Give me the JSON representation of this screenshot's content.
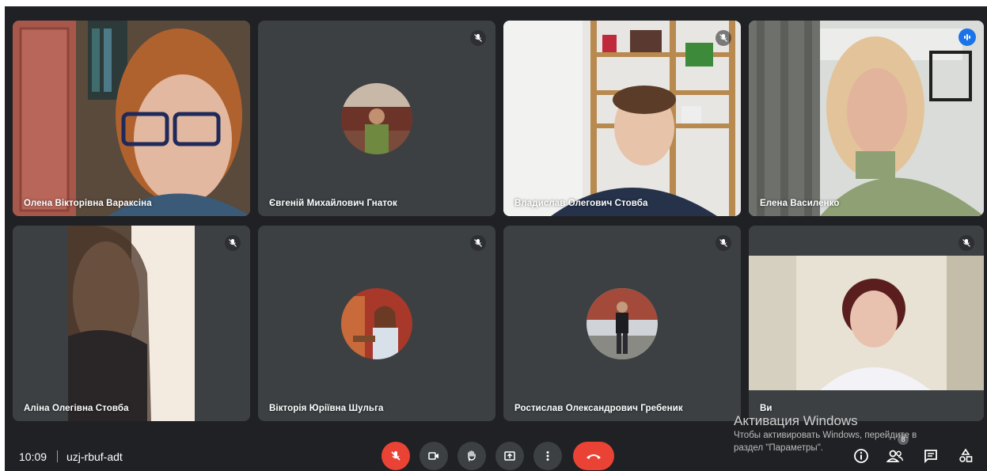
{
  "participants": [
    {
      "name": "Олена Вікторівна Вараксіна",
      "muted": false,
      "speaking": false
    },
    {
      "name": "Євгеній Михайлович Гнаток",
      "muted": true,
      "speaking": false
    },
    {
      "name": "Владислав Олегович Стовба",
      "muted": true,
      "speaking": false
    },
    {
      "name": "Елена Василенко",
      "muted": false,
      "speaking": true
    },
    {
      "name": "Аліна Олегівна Стовба",
      "muted": true,
      "speaking": false
    },
    {
      "name": "Вікторія Юріївна Шульга",
      "muted": true,
      "speaking": false
    },
    {
      "name": "Ростислав Олександрович Гребеник",
      "muted": true,
      "speaking": false
    },
    {
      "name": "Ви",
      "muted": true,
      "speaking": false
    }
  ],
  "meeting": {
    "time": "10:09",
    "code": "uzj-rbuf-adt",
    "people_count": "8"
  },
  "controls": {
    "icons": [
      "mic-off-icon",
      "camera-icon",
      "raise-hand-icon",
      "present-icon",
      "more-icon",
      "end-call-icon"
    ],
    "right_icons": [
      "info-icon",
      "people-icon",
      "chat-icon",
      "activities-icon"
    ]
  },
  "watermark": {
    "title": "Активация Windows",
    "line1": "Чтобы активировать Windows, перейдите в",
    "line2": "раздел \"Параметры\"."
  },
  "colors": {
    "background": "#202124",
    "tile": "#3c4043",
    "danger": "#ea4335",
    "accent": "#1a73e8"
  }
}
